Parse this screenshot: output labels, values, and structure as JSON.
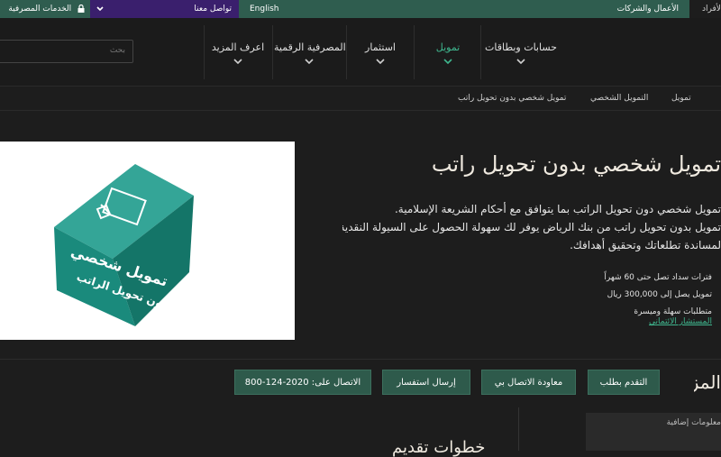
{
  "topbar": {
    "online_banking": "الخدمات المصرفية",
    "contact": "تواصل معنا",
    "language": "English",
    "business": "الأعمال والشركات",
    "individuals": "الأفراد"
  },
  "navbar": {
    "search_placeholder": "بحث",
    "items": [
      {
        "label": "حسابات وبطاقات"
      },
      {
        "label": "تمويل"
      },
      {
        "label": "استثمار"
      },
      {
        "label": "المصرفية الرقمية"
      },
      {
        "label": "اعرف المزيد"
      }
    ]
  },
  "breadcrumb": [
    "تمويل",
    "التمويل الشخصي",
    "تمويل شخصي بدون تحويل راتب"
  ],
  "hero": {
    "image_caption_line1": "تمويل شخصي",
    "image_caption_line2": "بدون تحويل الراتب",
    "title": "تمويل شخصي بدون تحويل راتب",
    "desc_line1": "تمويل شخصي دون تحويل الراتب بما يتوافق مع أحكام الشريعة الإسلامية.",
    "desc_line2": "تمويل بدون تحويل راتب من بنك الرياض يوفر لك سهولة الحصول على السيولة النقدية",
    "desc_line3": "لمساندة تطلعاتك وتحقيق أهدافك.",
    "features": [
      "فترات سداد تصل حتى 60 شهراً",
      "تمويل يصل إلى 300,000 ريال",
      "متطلبات سهلة وميسرة"
    ],
    "advisor_link": "المستشار الائتماني"
  },
  "actions": {
    "more_label": "المزيد:",
    "apply": "التقدم بطلب",
    "callback": "معاودة الاتصال بي",
    "inquiry": "إرسال استفسار",
    "call": "الاتصال على: 2020-124-800"
  },
  "bottom": {
    "panel_text": "معلومات إضافية",
    "heading": "خطوات تقديم"
  },
  "colors": {
    "accent": "#3fb68e",
    "topbar_green": "#2f5d4f",
    "contact_purple": "#3a1f6d",
    "button_green": "#2e5a4b"
  }
}
